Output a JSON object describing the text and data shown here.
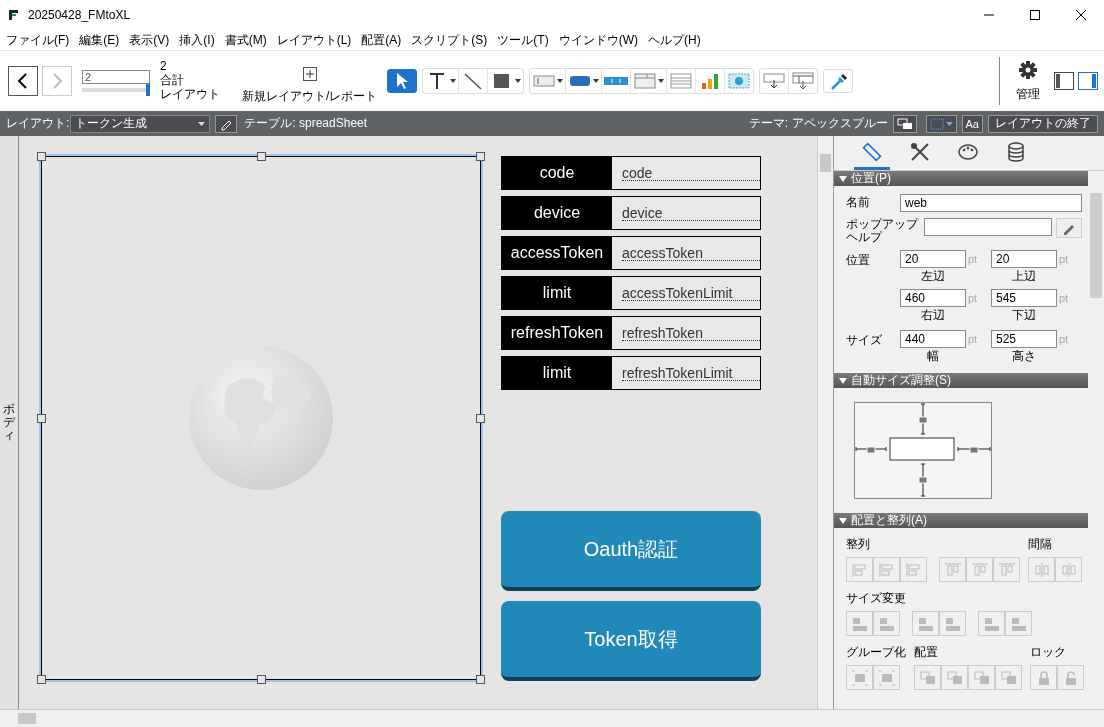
{
  "window": {
    "title": "20250428_FMtoXL"
  },
  "menu": [
    {
      "label": "ファイル(F)"
    },
    {
      "label": "編集(E)"
    },
    {
      "label": "表示(V)"
    },
    {
      "label": "挿入(I)"
    },
    {
      "label": "書式(M)"
    },
    {
      "label": "レイアウト(L)"
    },
    {
      "label": "配置(A)"
    },
    {
      "label": "スクリプト(S)"
    },
    {
      "label": "ツール(T)"
    },
    {
      "label": "ウインドウ(W)"
    },
    {
      "label": "ヘルプ(H)"
    }
  ],
  "toolbar": {
    "nav": [
      {
        "kind": "back",
        "disabled": false
      },
      {
        "kind": "forward",
        "disabled": true
      }
    ],
    "record_field": {
      "value": "2"
    },
    "record_slider": {
      "level": 1
    },
    "total": "2",
    "total_label": "合計",
    "mode_label": "レイアウト",
    "new_layout": "新規レイアウト/レポート",
    "tools": [
      [
        {
          "kind": "pointer",
          "selected": true,
          "menu": false
        }
      ],
      [
        {
          "kind": "text",
          "selected": false,
          "menu": true
        },
        {
          "kind": "line",
          "selected": false,
          "menu": false
        },
        {
          "kind": "shape",
          "selected": false,
          "menu": true
        }
      ],
      [
        {
          "kind": "field",
          "selected": false,
          "menu": true
        },
        {
          "kind": "button",
          "selected": false,
          "menu": true
        },
        {
          "kind": "buttonbar",
          "selected": false,
          "menu": false
        },
        {
          "kind": "popover",
          "selected": false,
          "menu": true
        },
        {
          "kind": "portal",
          "selected": false,
          "menu": false
        },
        {
          "kind": "chart",
          "selected": false,
          "menu": false
        },
        {
          "kind": "webviewer",
          "selected": false,
          "menu": false
        }
      ],
      [
        {
          "kind": "insert-field",
          "selected": false,
          "menu": false
        },
        {
          "kind": "insert-portal",
          "selected": false,
          "menu": false
        }
      ],
      [
        {
          "kind": "eyedropper",
          "selected": false,
          "menu": false
        }
      ]
    ],
    "manage": "管理",
    "panes": [
      {
        "kind": "left",
        "selected": false
      },
      {
        "kind": "right",
        "selected": true
      }
    ]
  },
  "layout_bar": {
    "layout_label": "レイアウト:",
    "layout": "トークン生成",
    "table": "テーブル: spreadSheet",
    "theme": "テーマ: アペックスブルー",
    "font_button": "Aa",
    "exit": "レイアウトの終了"
  },
  "canvas": {
    "part_label": "ボディ",
    "fields": [
      {
        "label": "code",
        "field": "code"
      },
      {
        "label": "device",
        "field": "device"
      },
      {
        "label": "accessToken",
        "field": "accessToken"
      },
      {
        "label": "limit",
        "field": "accessTokenLimit"
      },
      {
        "label": "refreshToken",
        "field": "refreshToken"
      },
      {
        "label": "limit",
        "field": "refreshTokenLimit"
      }
    ],
    "buttons": [
      "Oauth認証",
      "Token取得"
    ]
  },
  "inspector": {
    "tabs": [
      {
        "kind": "ruler",
        "selected": true
      },
      {
        "kind": "tools",
        "selected": false
      },
      {
        "kind": "palette",
        "selected": false
      },
      {
        "kind": "database",
        "selected": false
      }
    ],
    "position": {
      "title": "位置(P)",
      "expanded": true,
      "name_label": "名前",
      "name": "web",
      "tooltip_label": "ポップアップヘルプ",
      "pos_label": "位置",
      "size_label": "サイズ",
      "pos": [
        {
          "value": "20",
          "unit": "pt",
          "caption": "左辺"
        },
        {
          "value": "20",
          "unit": "pt",
          "caption": "上辺"
        },
        {
          "value": "460",
          "unit": "pt",
          "caption": "右辺"
        },
        {
          "value": "545",
          "unit": "pt",
          "caption": "下辺"
        }
      ],
      "size": [
        {
          "value": "440",
          "unit": "pt",
          "caption": "幅"
        },
        {
          "value": "525",
          "unit": "pt",
          "caption": "高さ"
        }
      ]
    },
    "autosize": {
      "title": "自動サイズ調整(S)",
      "expanded": true
    },
    "arrange": {
      "title": "配置と整列(A)",
      "expanded": true,
      "disabled": true,
      "align_label": "整列",
      "spacing_label": "間隔",
      "resize_label": "サイズ変更",
      "group_label": "グループ化",
      "order_label": "配置",
      "lock_label": "ロック"
    }
  }
}
